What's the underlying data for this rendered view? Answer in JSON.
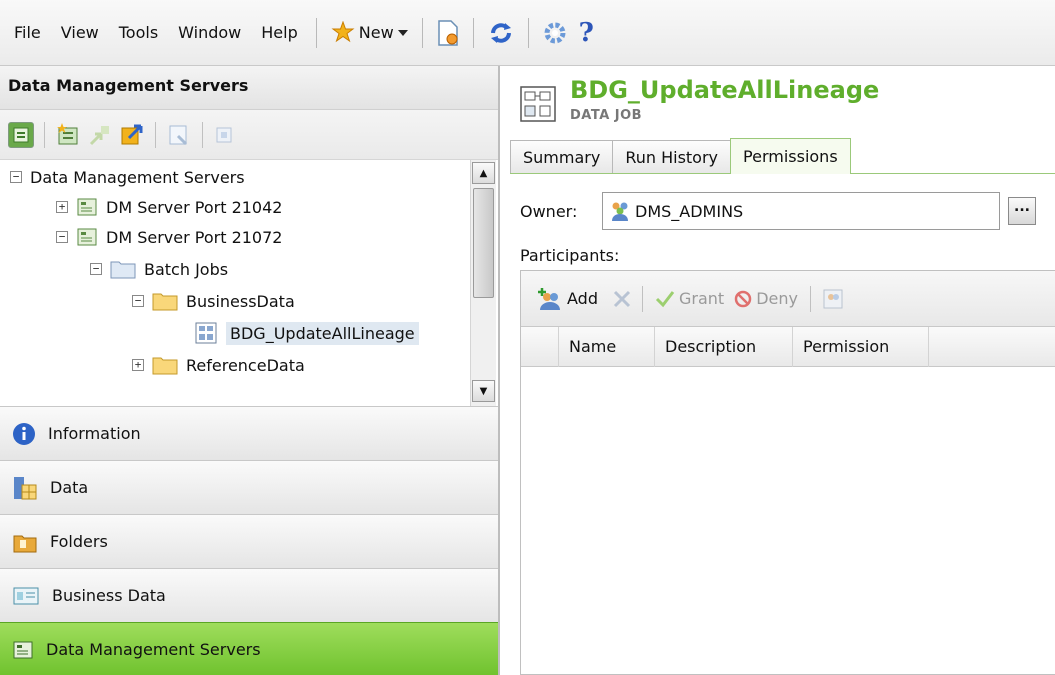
{
  "menubar": {
    "items": [
      "File",
      "View",
      "Tools",
      "Window",
      "Help"
    ],
    "new_label": "New",
    "icons": [
      "new-icon",
      "chevron-down-icon",
      "document-icon",
      "refresh-icon",
      "settings-icon",
      "help-icon"
    ]
  },
  "left_pane": {
    "title": "Data Management Servers",
    "tree": [
      {
        "label": "Data Management Servers",
        "expander": "−"
      },
      {
        "label": "DM Server Port 21042",
        "expander": "+"
      },
      {
        "label": "DM Server Port 21072",
        "expander": "−"
      },
      {
        "label": "Batch Jobs",
        "expander": "−"
      },
      {
        "label": "BusinessData",
        "expander": "−"
      },
      {
        "label": "BDG_UpdateAllLineage",
        "expander": ""
      },
      {
        "label": "ReferenceData",
        "expander": "+"
      }
    ],
    "accordion": [
      {
        "label": "Information"
      },
      {
        "label": "Data"
      },
      {
        "label": "Folders"
      },
      {
        "label": "Business Data"
      },
      {
        "label": "Data Management Servers"
      }
    ]
  },
  "detail": {
    "title": "BDG_UpdateAllLineage",
    "subtitle": "DATA JOB",
    "tabs": [
      {
        "label": "Summary"
      },
      {
        "label": "Run History"
      },
      {
        "label": "Permissions"
      }
    ],
    "owner_label": "Owner:",
    "owner_value": "DMS_ADMINS",
    "browse_label": "...",
    "participants_label": "Participants:",
    "toolbar": {
      "add": "Add",
      "grant": "Grant",
      "deny": "Deny"
    },
    "columns": [
      "Name",
      "Description",
      "Permission"
    ]
  },
  "colors": {
    "accent_green": "#5fae2c",
    "active_accordion": "#8fd44a",
    "selection": "#dfe8f1"
  }
}
